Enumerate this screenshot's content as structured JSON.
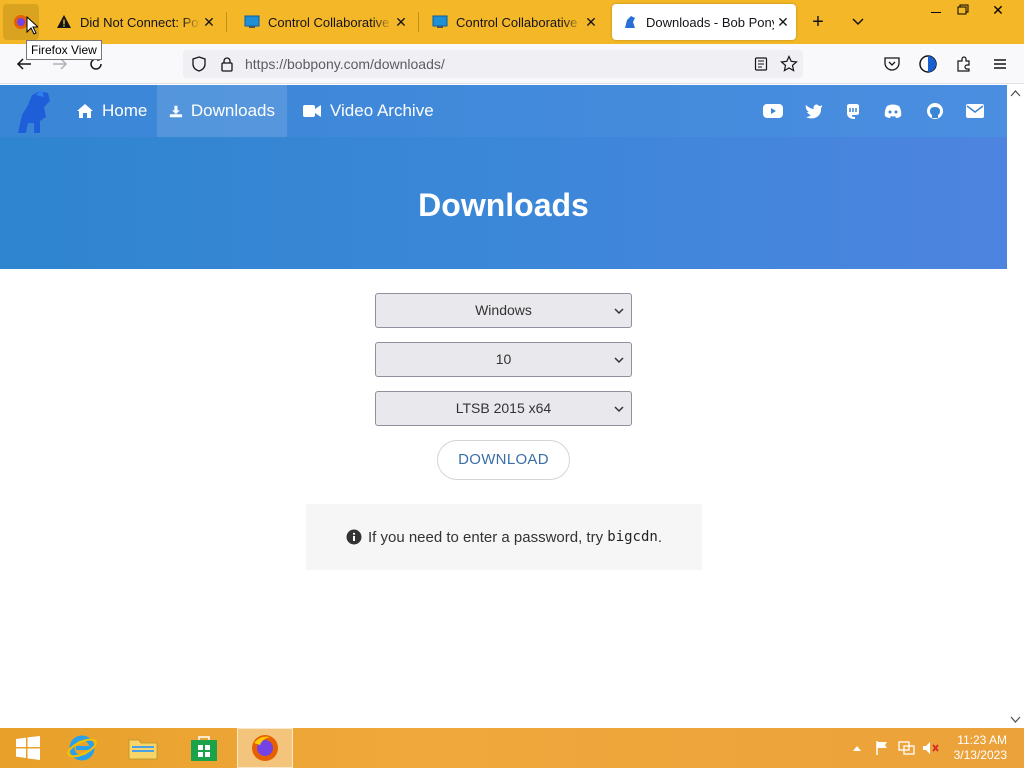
{
  "browser": {
    "tooltip": "Firefox View",
    "tabs": [
      {
        "label": "Did Not Connect: Potential Security Issue"
      },
      {
        "label": "Control Collaborative Virtual Machine"
      },
      {
        "label": "Control Collaborative Virtual Machine"
      },
      {
        "label": "Downloads - Bob Pony"
      }
    ],
    "url": "https://bobpony.com/downloads/"
  },
  "site": {
    "nav": [
      {
        "label": "Home",
        "icon": "home-icon"
      },
      {
        "label": "Downloads",
        "icon": "download-icon"
      },
      {
        "label": "Video Archive",
        "icon": "video-camera-icon"
      }
    ],
    "social_icons": [
      "youtube-icon",
      "twitter-icon",
      "mastodon-icon",
      "discord-icon",
      "github-icon",
      "email-icon"
    ],
    "hero_title": "Downloads",
    "selects": [
      {
        "name": "os-select",
        "value": "Windows"
      },
      {
        "name": "version-select",
        "value": "10"
      },
      {
        "name": "edition-select",
        "value": "LTSB 2015 x64"
      }
    ],
    "download_button": "DOWNLOAD",
    "notice": {
      "text": "If you need to enter a password, try ",
      "code": "bigcdn",
      "suffix": "."
    }
  },
  "taskbar": {
    "apps": [
      "start-icon",
      "internet-explorer-icon",
      "file-explorer-icon",
      "store-icon",
      "firefox-icon"
    ],
    "time": "11:23 AM",
    "date": "3/13/2023"
  },
  "colors": {
    "tabstrip": "#f3b727",
    "site_nav": "#3a86d6",
    "hero": "#3b87d8",
    "taskbar": "#eba23a"
  }
}
